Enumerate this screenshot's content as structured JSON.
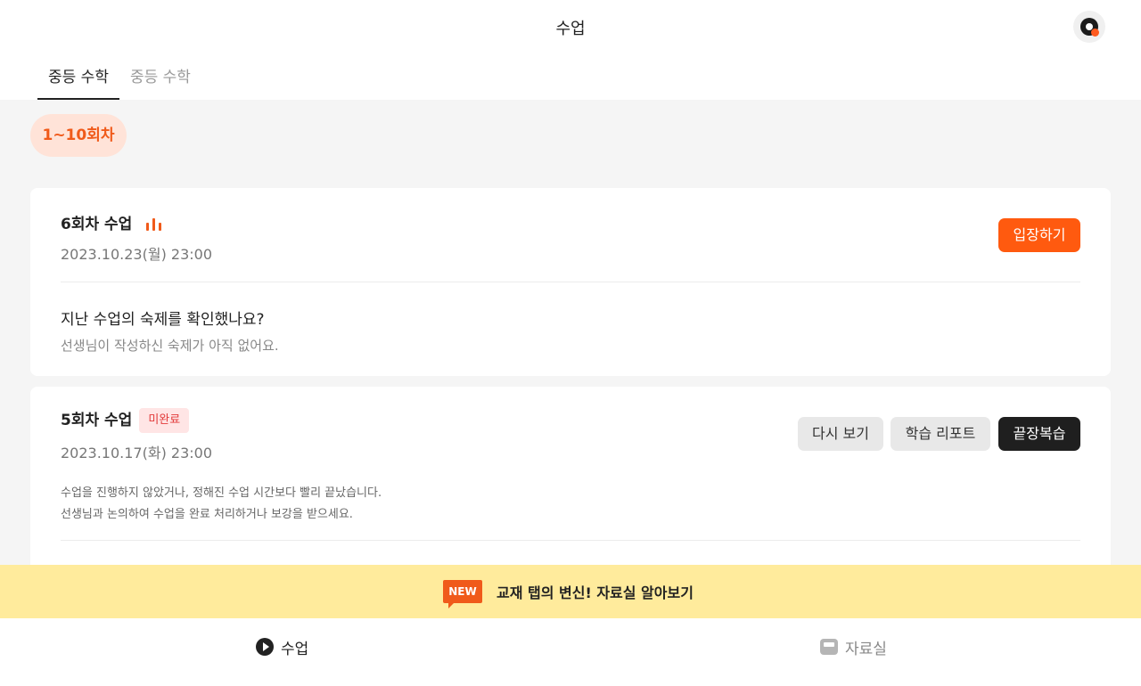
{
  "header": {
    "title": "수업"
  },
  "tabs": [
    {
      "label": "중등 수학",
      "active": true
    },
    {
      "label": "중등 수학",
      "active": false
    }
  ],
  "filter_chip": "1~10회차",
  "lessons": [
    {
      "title": "6회차 수업",
      "date": "2023.10.23(월) 23:00",
      "enter_label": "입장하기",
      "homework_question": "지난 수업의 숙제를 확인했나요?",
      "homework_status": "선생님이 작성하신 숙제가 아직 없어요."
    },
    {
      "title": "5회차 수업",
      "badge": "미완료",
      "date": "2023.10.17(화) 23:00",
      "buttons": {
        "rewatch": "다시 보기",
        "report": "학습 리포트",
        "review": "끝장복습"
      },
      "notice_line1": "수업을 진행하지 않았거나, 정해진 수업 시간보다 빨리 끝났습니다.",
      "notice_line2": "선생님과 논의하여 수업을 완료 처리하거나 보강을 받으세요."
    }
  ],
  "banner": {
    "badge": "NEW",
    "text": "교재 탭의 변신! 자료실 알아보기"
  },
  "bottom_nav": [
    {
      "label": "수업",
      "icon": "play-circle-icon",
      "active": true
    },
    {
      "label": "자료실",
      "icon": "inbox-icon",
      "active": false
    }
  ],
  "colors": {
    "accent": "#ff5a0f",
    "chip_bg": "#ffe3d8",
    "banner_bg": "#ffeb9c",
    "badge_bg": "#ffe5e5",
    "badge_text": "#e23b3b"
  }
}
